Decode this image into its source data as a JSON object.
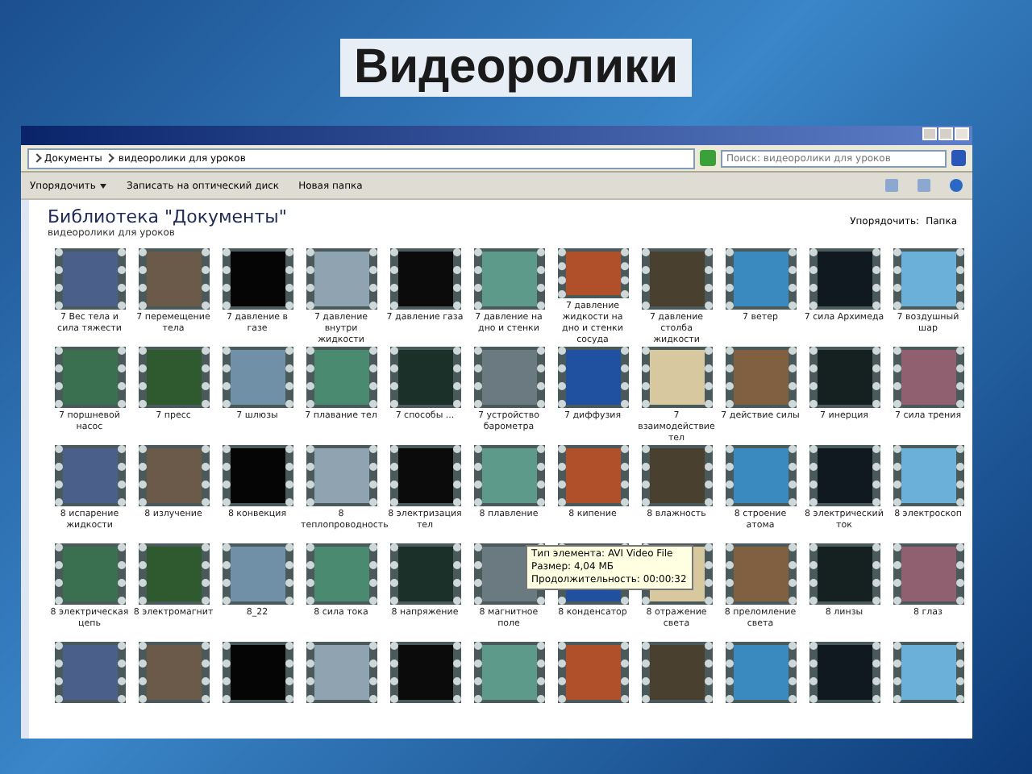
{
  "slide_title": "Видеоролики",
  "window": {
    "address": [
      "Документы",
      "видеоролики для уроков"
    ],
    "search": {
      "placeholder": "Поиск: видеоролики для уроков"
    },
    "toolbar": [
      "Упорядочить",
      "Записать на оптический диск",
      "Новая папка"
    ],
    "library_title": "Библиотека \"Документы\"",
    "library_subtitle": "видеоролики для уроков",
    "arrange_label": "Упорядочить:",
    "arrange_value": "Папка",
    "videos": [
      {
        "caption": "7 Вес тела и сила тяжести"
      },
      {
        "caption": "7 перемещение тела"
      },
      {
        "caption": "7 давление в газе"
      },
      {
        "caption": "7 давление внутри жидкости"
      },
      {
        "caption": "7 давление газа"
      },
      {
        "caption": "7 давление на дно и стенки"
      },
      {
        "caption": "7 давление жидкости на дно и стенки сосуда"
      },
      {
        "caption": "7 давление столба жидкости"
      },
      {
        "caption": "7 ветер"
      },
      {
        "caption": "7 сила Архимеда"
      },
      {
        "caption": "7 воздушный шар"
      },
      {
        "caption": "7 поршневой насос"
      },
      {
        "caption": "7 пресс"
      },
      {
        "caption": "7 шлюзы"
      },
      {
        "caption": "7 плавание тел"
      },
      {
        "caption": "7 способы ..."
      },
      {
        "caption": "7 устройство барометра"
      },
      {
        "caption": "7 диффузия"
      },
      {
        "caption": "7 взаимодействие тел"
      },
      {
        "caption": "7 действие силы"
      },
      {
        "caption": "7 инерция"
      },
      {
        "caption": "7 сила трения"
      },
      {
        "caption": "8 испарение жидкости"
      },
      {
        "caption": "8 излучение"
      },
      {
        "caption": "8 конвекция"
      },
      {
        "caption": "8 теплопроводность"
      },
      {
        "caption": "8 электризация тел"
      },
      {
        "caption": "8 плавление"
      },
      {
        "caption": "8 кипение"
      },
      {
        "caption": "8 влажность"
      },
      {
        "caption": "8 строение атома"
      },
      {
        "caption": "8 электрический ток"
      },
      {
        "caption": "8 электроскоп"
      },
      {
        "caption": "8 электрическая цепь"
      },
      {
        "caption": "8 электромагнит"
      },
      {
        "caption": "8_22"
      },
      {
        "caption": "8 сила тока"
      },
      {
        "caption": "8 напряжение"
      },
      {
        "caption": "8 магнитное поле"
      },
      {
        "caption": "8 конденсатор"
      },
      {
        "caption": "8 отражение света"
      },
      {
        "caption": "8 преломление света"
      },
      {
        "caption": "8 линзы"
      },
      {
        "caption": "8 глаз"
      },
      {
        "kind": "video"
      },
      {
        "kind": "video"
      },
      {
        "kind": "video"
      },
      {
        "kind": "video"
      },
      {
        "kind": "video"
      },
      {
        "kind": "video"
      },
      {
        "kind": "video"
      },
      {
        "kind": "video"
      },
      {
        "kind": "video"
      },
      {
        "kind": "video"
      },
      {
        "kind": "video"
      }
    ],
    "tooltip": {
      "lines": [
        "Тип элемента: AVI Video File",
        "Размер: 4,04 МБ",
        "Продолжительность: 00:00:32"
      ]
    }
  }
}
